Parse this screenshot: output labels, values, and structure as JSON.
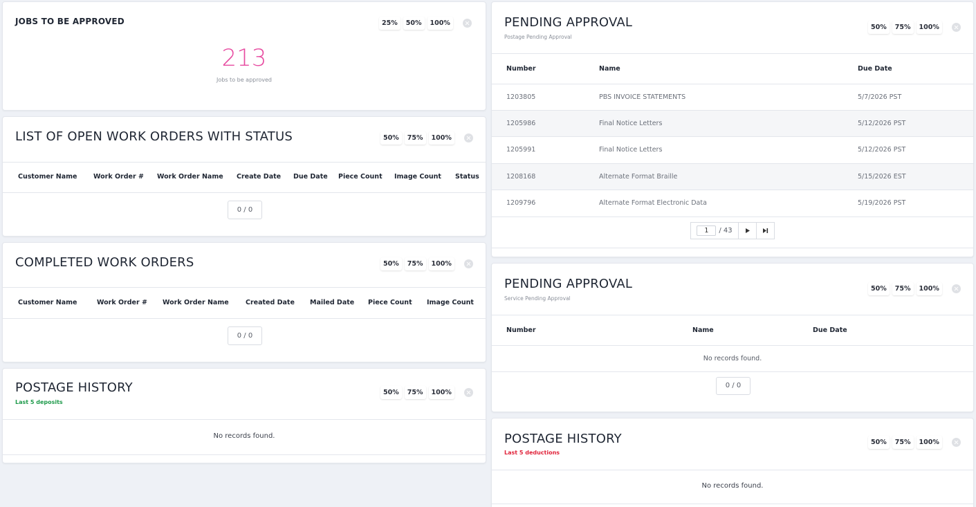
{
  "jobs_card": {
    "title": "JOBS TO BE APPROVED",
    "value": "213",
    "caption": "Jobs to be approved",
    "zoom": [
      "25%",
      "50%",
      "100%"
    ]
  },
  "open_orders": {
    "title": "LIST OF OPEN WORK ORDERS WITH STATUS",
    "zoom": [
      "50%",
      "75%",
      "100%"
    ],
    "columns": [
      "Customer Name",
      "Work Order #",
      "Work Order Name",
      "Create Date",
      "Due Date",
      "Piece Count",
      "Image Count",
      "Status"
    ],
    "pager": "0 / 0"
  },
  "completed_orders": {
    "title": "COMPLETED WORK ORDERS",
    "zoom": [
      "50%",
      "75%",
      "100%"
    ],
    "columns": [
      "Customer Name",
      "Work Order #",
      "Work Order Name",
      "Created Date",
      "Mailed Date",
      "Piece Count",
      "Image Count"
    ],
    "pager": "0 / 0"
  },
  "postage_history_deposits": {
    "title": "POSTAGE HISTORY",
    "subtitle": "Last 5 deposits",
    "zoom": [
      "50%",
      "75%",
      "100%"
    ],
    "empty": "No records found."
  },
  "pending_postage": {
    "title": "PENDING APPROVAL",
    "subtitle": "Postage Pending Approval",
    "zoom": [
      "50%",
      "75%",
      "100%"
    ],
    "columns": [
      "Number",
      "Name",
      "Due Date"
    ],
    "rows": [
      [
        "1203805",
        "PBS INVOICE STATEMENTS",
        "5/7/2026 PST"
      ],
      [
        "1205986",
        "Final Notice Letters",
        "5/12/2026 PST"
      ],
      [
        "1205991",
        "Final Notice Letters",
        "5/12/2026 PST"
      ],
      [
        "1208168",
        "Alternate Format Braille",
        "5/15/2026 EST"
      ],
      [
        "1209796",
        "Alternate Format Electronic Data",
        "5/19/2026 PST"
      ]
    ],
    "pager": {
      "current": "1",
      "total": "/ 43"
    }
  },
  "pending_service": {
    "title": "PENDING APPROVAL",
    "subtitle": "Service Pending Approval",
    "zoom": [
      "50%",
      "75%",
      "100%"
    ],
    "columns": [
      "Number",
      "Name",
      "Due Date"
    ],
    "empty": "No records found.",
    "pager": "0 / 0"
  },
  "postage_history_deductions": {
    "title": "POSTAGE HISTORY",
    "subtitle": "Last 5 deductions",
    "zoom": [
      "50%",
      "75%",
      "100%"
    ],
    "empty": "No records found."
  }
}
